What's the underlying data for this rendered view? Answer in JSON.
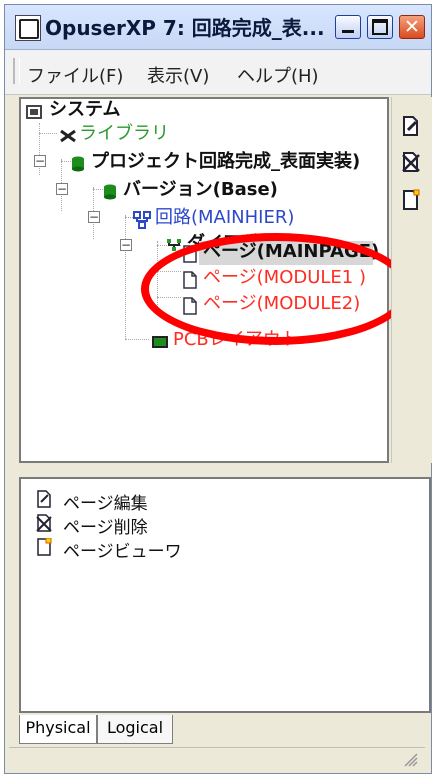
{
  "window": {
    "title": "OpuserXP 7: 回路完成_表..."
  },
  "menu": {
    "file": "ファイル(F)",
    "view": "表示(V)",
    "help": "ヘルプ(H)"
  },
  "tree": {
    "system": "システム",
    "library": "ライブラリ",
    "project": "プロジェクト回路完成_表面実装)",
    "version": "バージョン(Base)",
    "circuit": "回路(MAINHIER)",
    "diagram": "ダイアグラム",
    "pages": [
      "ページ(MAINPAGE)",
      "ページ(MODULE1 )",
      "ページ(MODULE2)"
    ],
    "pcb": "PCBレイアウト"
  },
  "toolbar": {
    "icons": [
      "page-edit-icon",
      "page-delete-icon",
      "page-viewer-icon"
    ]
  },
  "tasks": {
    "page_edit": "ページ編集",
    "page_delete": "ページ削除",
    "page_viewer": "ページビューワ"
  },
  "tabs": {
    "physical": "Physical",
    "logical": "Logical"
  },
  "colors": {
    "accent_red": "#ff0000",
    "tree_blue": "#2d49c8",
    "tree_green": "#2a9b2a",
    "tree_red": "#ff2c22"
  }
}
